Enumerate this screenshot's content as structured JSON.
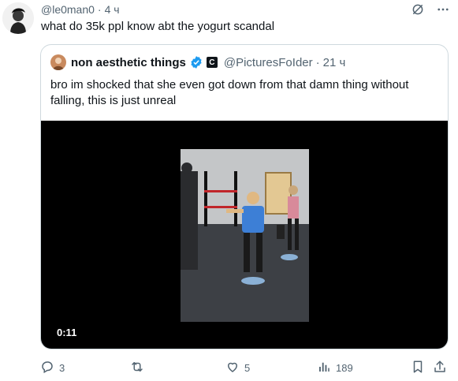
{
  "tweet": {
    "handle": "@le0man0",
    "time": "4 ч",
    "text": "what do 35k ppl know abt the yogurt scandal"
  },
  "quoted": {
    "name": "non aesthetic things",
    "affiliate_badge": "C",
    "handle": "@PicturesFoIder",
    "time": "21 ч",
    "text": "bro im shocked that she even got down from that damn thing without falling, this is just unreal",
    "video_duration": "0:11"
  },
  "actions": {
    "replies": "3",
    "reposts": "",
    "likes": "5",
    "views": "189"
  },
  "colors": {
    "text": "#0f1419",
    "secondary": "#536471",
    "border": "#cfd9de",
    "verified": "#1d9bf0"
  }
}
